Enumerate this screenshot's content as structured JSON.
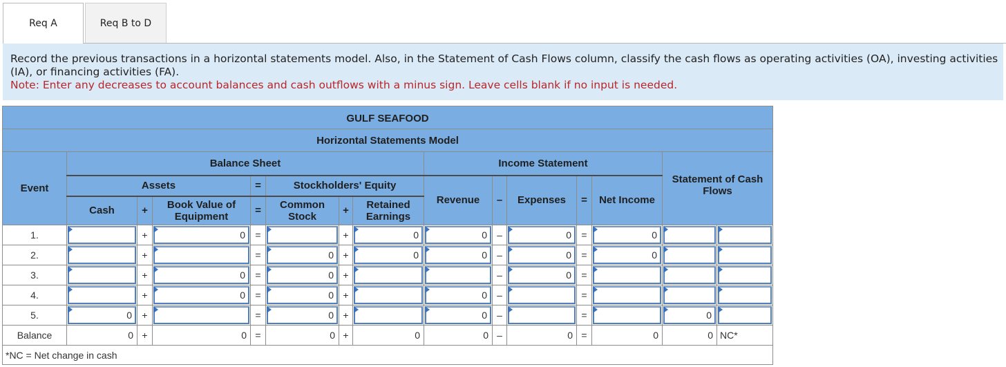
{
  "tabs": [
    {
      "label": "Req A",
      "active": true
    },
    {
      "label": "Req B to D",
      "active": false
    }
  ],
  "instructions": {
    "text": "Record the previous transactions in a horizontal statements model. Also, in the Statement of Cash Flows column, classify the cash flows as operating activities (OA), investing activities (IA), or financing activities (FA).",
    "note": "Note: Enter any decreases to account balances and cash outflows with a minus sign. Leave cells blank if no input is needed."
  },
  "table": {
    "company": "GULF SEAFOOD",
    "title": "Horizontal Statements Model",
    "headers": {
      "event": "Event",
      "balance_sheet": "Balance Sheet",
      "assets": "Assets",
      "equals": "=",
      "stockholders_equity": "Stockholders' Equity",
      "cash": "Cash",
      "plus": "+",
      "book_value": "Book Value of Equipment",
      "common_stock": "Common Stock",
      "retained_earnings": "Retained Earnings",
      "income_statement": "Income Statement",
      "revenue": "Revenue",
      "minus": "–",
      "expenses": "Expenses",
      "net_income": "Net Income",
      "scf": "Statement of Cash Flows"
    },
    "rows": [
      {
        "event": "1.",
        "cash": "",
        "book_value": "0",
        "common_stock": "",
        "retained_earnings": "0",
        "revenue": "0",
        "expenses": "0",
        "net_income": "0",
        "scf_amount": "",
        "scf_class": ""
      },
      {
        "event": "2.",
        "cash": "",
        "book_value": "",
        "common_stock": "0",
        "retained_earnings": "0",
        "revenue": "0",
        "expenses": "0",
        "net_income": "0",
        "scf_amount": "",
        "scf_class": ""
      },
      {
        "event": "3.",
        "cash": "",
        "book_value": "0",
        "common_stock": "0",
        "retained_earnings": "",
        "revenue": "",
        "expenses": "0",
        "net_income": "",
        "scf_amount": "",
        "scf_class": ""
      },
      {
        "event": "4.",
        "cash": "",
        "book_value": "0",
        "common_stock": "0",
        "retained_earnings": "",
        "revenue": "0",
        "expenses": "",
        "net_income": "",
        "scf_amount": "",
        "scf_class": ""
      },
      {
        "event": "5.",
        "cash": "0",
        "book_value": "",
        "common_stock": "0",
        "retained_earnings": "",
        "revenue": "0",
        "expenses": "",
        "net_income": "",
        "scf_amount": "0",
        "scf_class": ""
      }
    ],
    "balance": {
      "event": "Balance",
      "cash": "0",
      "book_value": "0",
      "common_stock": "0",
      "retained_earnings": "0",
      "revenue": "0",
      "expenses": "0",
      "net_income": "0",
      "scf_amount": "0",
      "scf_class": "NC*"
    },
    "footnote": "*NC = Net change in cash"
  }
}
